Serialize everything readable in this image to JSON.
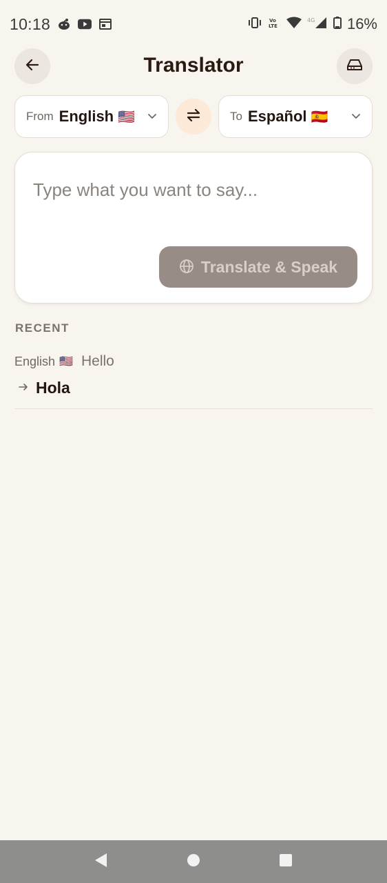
{
  "status_bar": {
    "time": "10:18",
    "battery": "16%",
    "network": "4G",
    "notification_icons": [
      "reddit-icon",
      "youtube-icon",
      "calendar-icon"
    ],
    "system_icons": [
      "vibrate-icon",
      "volte-icon",
      "wifi-icon",
      "signal-icon",
      "battery-icon"
    ]
  },
  "header": {
    "title": "Translator",
    "back_icon": "arrow-left-icon",
    "history_icon": "drive-icon"
  },
  "languages": {
    "from_prefix": "From",
    "from_name": "English",
    "from_flag": "🇺🇸",
    "to_prefix": "To",
    "to_name": "Español",
    "to_flag": "🇪🇸",
    "swap_icon": "swap-arrows-icon"
  },
  "input": {
    "value": "",
    "placeholder": "Type what you want to say..."
  },
  "translate_button": {
    "label": "Translate & Speak",
    "icon": "globe-icon"
  },
  "recent": {
    "label": "RECENT",
    "items": [
      {
        "source_lang": "English",
        "source_flag": "🇺🇸",
        "source_text": "Hello",
        "target_text": "Hola"
      }
    ]
  },
  "colors": {
    "background": "#f8f5ef",
    "card": "#ffffff",
    "swap_accent": "#fde9d8",
    "button_disabled": "#978d86",
    "nav_bar": "#8e8e8c"
  }
}
